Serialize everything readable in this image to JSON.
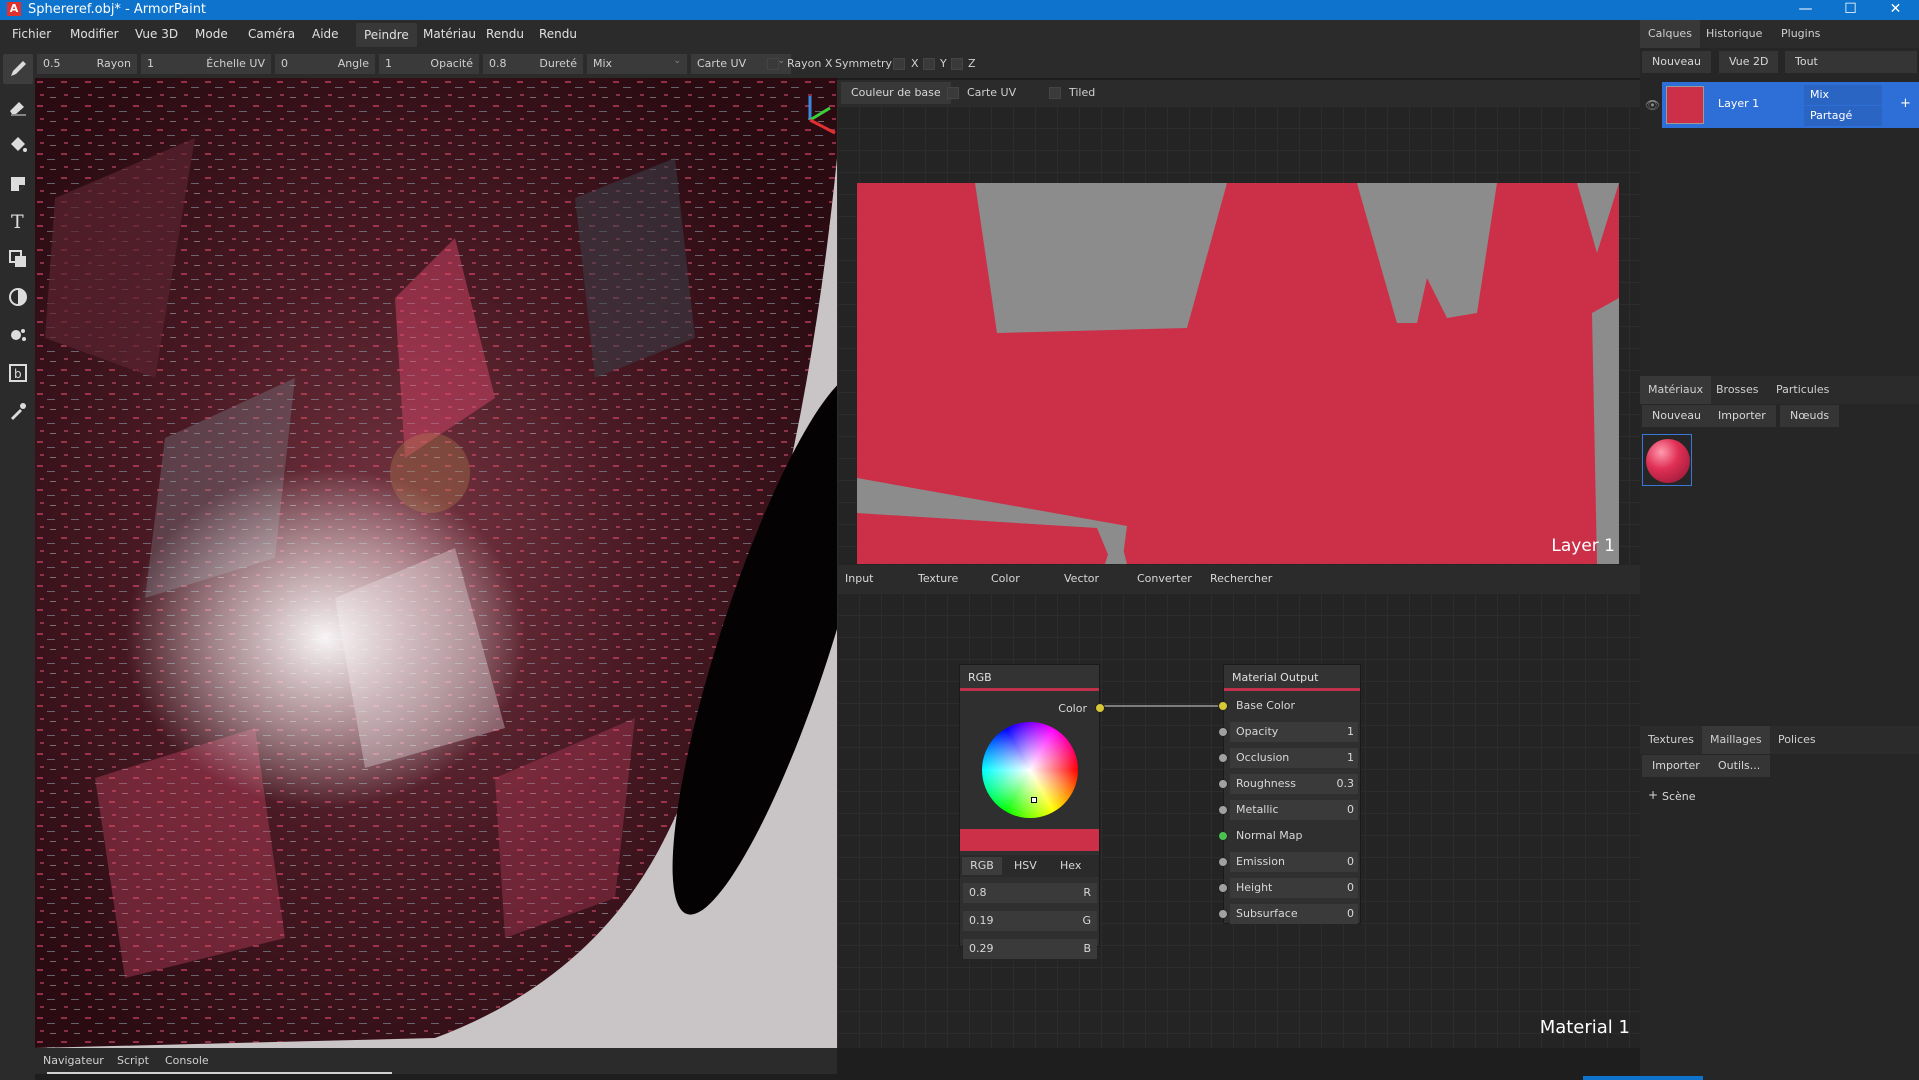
{
  "window": {
    "title": "Sphereref.obj* - ArmorPaint",
    "logo_letter": "A",
    "minimize": "—",
    "maximize": "☐",
    "close": "✕"
  },
  "menu": [
    "Fichier",
    "Modifier",
    "Vue 3D",
    "Mode",
    "Caméra",
    "Aide",
    "Peindre",
    "Matériau",
    "Rendu",
    "Rendu"
  ],
  "toolbar": {
    "radius_value": "0.5",
    "radius_label": "Rayon",
    "uvscale_value": "1",
    "uvscale_label": "Échelle UV",
    "angle_value": "0",
    "angle_label": "Angle",
    "opacity_value": "1",
    "opacity_label": "Opacité",
    "hardness_value": "0.8",
    "hardness_label": "Dureté",
    "blend_value": "Mix",
    "texcoord_value": "Carte UV",
    "rayon_x_label": "Rayon X",
    "symmetry_label": "Symmetry",
    "x_label": "X",
    "y_label": "Y",
    "z_label": "Z"
  },
  "tools": [
    "brush-icon",
    "eraser-icon",
    "fill-icon",
    "decal-icon",
    "text-icon",
    "clone-icon",
    "blur-icon",
    "particle-icon",
    "bake-icon",
    "picker-icon"
  ],
  "bottom_tabs": [
    "Navigateur",
    "Script",
    "Console"
  ],
  "view2d": {
    "mode": "Couleur de base",
    "uvmap_label": "Carte UV",
    "tiled_label": "Tiled",
    "layer_name": "Layer 1"
  },
  "node_menu": [
    "Input",
    "Texture",
    "Color",
    "Vector",
    "Converter",
    "Rechercher"
  ],
  "node_rgb": {
    "title": "RGB",
    "output_label": "Color",
    "tabs": [
      "RGB",
      "HSV",
      "Hex"
    ],
    "channels": [
      {
        "value": "0.8",
        "label": "R"
      },
      {
        "value": "0.19",
        "label": "G"
      },
      {
        "value": "0.29",
        "label": "B"
      }
    ],
    "swatch_color": "#cc3049"
  },
  "node_output": {
    "title": "Material Output",
    "inputs": [
      {
        "label": "Base Color",
        "value": ""
      },
      {
        "label": "Opacity",
        "value": "1"
      },
      {
        "label": "Occlusion",
        "value": "1"
      },
      {
        "label": "Roughness",
        "value": "0.3"
      },
      {
        "label": "Metallic",
        "value": "0"
      },
      {
        "label": "Normal Map",
        "value": ""
      },
      {
        "label": "Emission",
        "value": "0"
      },
      {
        "label": "Height",
        "value": "0"
      },
      {
        "label": "Subsurface",
        "value": "0"
      }
    ]
  },
  "material_name": "Material 1",
  "right_panel": {
    "top_tabs": [
      "Calques",
      "Historique",
      "Plugins"
    ],
    "layer_buttons": [
      "Nouveau",
      "Vue 2D",
      "Tout"
    ],
    "layer": {
      "name": "Layer 1",
      "blend": "Mix",
      "mask": "Partagé",
      "add": "+"
    },
    "mat_tabs": [
      "Matériaux",
      "Brosses",
      "Particules"
    ],
    "mat_buttons": [
      "Nouveau",
      "Importer",
      "Nœuds"
    ],
    "tex_tabs": [
      "Textures",
      "Maillages",
      "Polices"
    ],
    "tex_buttons": [
      "Importer",
      "Outils..."
    ],
    "scene_label": "Scène",
    "scene_icon": "+"
  },
  "colors": {
    "accent": "#0d73cc",
    "paint": "#cc3049",
    "node_header_bar": "#c0324b"
  }
}
